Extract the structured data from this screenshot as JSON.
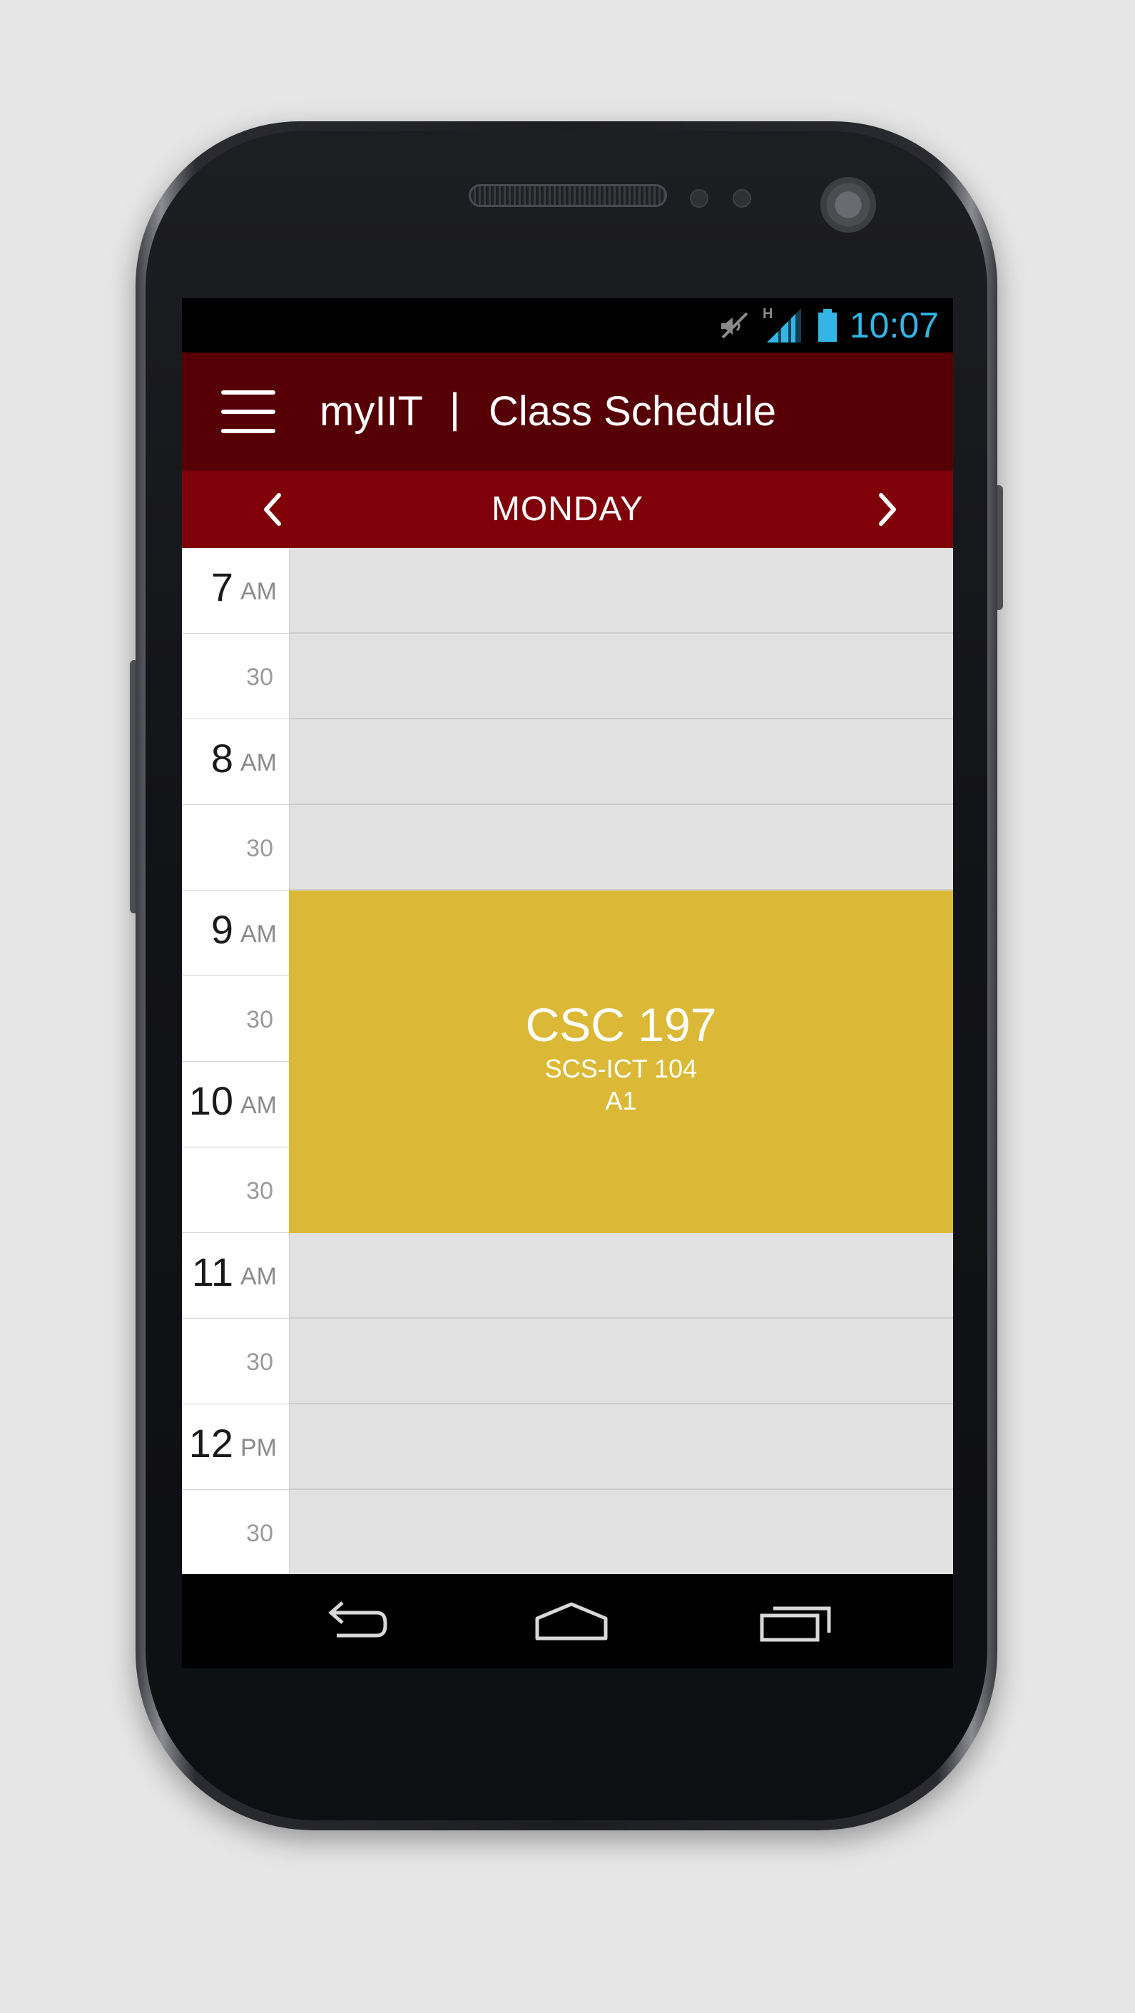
{
  "status_bar": {
    "time": "10:07",
    "network_type": "H",
    "icons": [
      "mute-icon",
      "signal-icon",
      "battery-icon"
    ],
    "time_color": "#33b5e5"
  },
  "app_bar": {
    "app_name": "myIIT",
    "separator": "|",
    "section_title": "Class Schedule",
    "menu_icon": "hamburger-menu-icon",
    "color": "#560006"
  },
  "day_nav": {
    "day": "MONDAY",
    "prev_icon": "chevron-left-icon",
    "next_icon": "chevron-right-icon",
    "color": "#80000a"
  },
  "time_slots": [
    {
      "hour": "7",
      "period": "AM"
    },
    {
      "half": "30"
    },
    {
      "hour": "8",
      "period": "AM"
    },
    {
      "half": "30"
    },
    {
      "hour": "9",
      "period": "AM"
    },
    {
      "half": "30"
    },
    {
      "hour": "10",
      "period": "AM"
    },
    {
      "half": "30"
    },
    {
      "hour": "11",
      "period": "AM"
    },
    {
      "half": "30"
    },
    {
      "hour": "12",
      "period": "PM"
    },
    {
      "half": "30"
    }
  ],
  "classes": [
    {
      "code": "CSC 197",
      "room": "SCS-ICT 104",
      "section": "A1",
      "start": "9:00 AM",
      "end": "11:00 AM",
      "color": "#dbb936"
    }
  ],
  "nav_bar": {
    "icons": [
      "back-icon",
      "home-icon",
      "recent-apps-icon"
    ]
  }
}
